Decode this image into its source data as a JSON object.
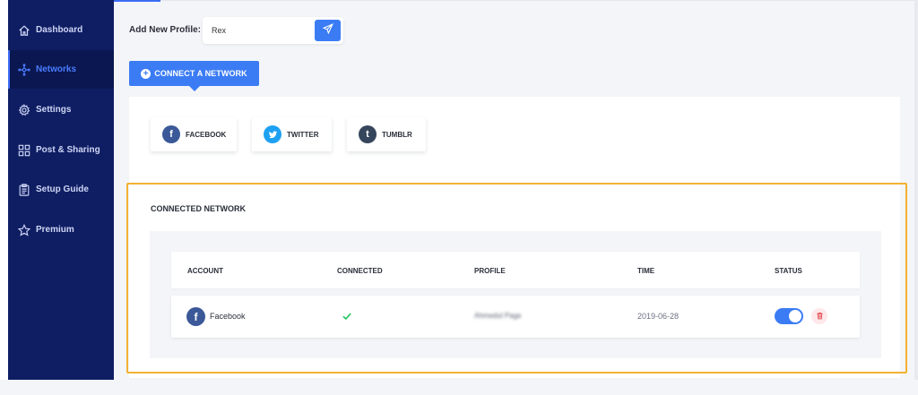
{
  "sidebar": {
    "items": [
      {
        "label": "Dashboard",
        "icon": "home-icon"
      },
      {
        "label": "Networks",
        "icon": "network-icon",
        "active": true
      },
      {
        "label": "Settings",
        "icon": "gear-icon"
      },
      {
        "label": "Post & Sharing",
        "icon": "layout-icon"
      },
      {
        "label": "Setup Guide",
        "icon": "clipboard-icon"
      },
      {
        "label": "Premium",
        "icon": "star-icon"
      }
    ]
  },
  "profile": {
    "label": "Add New Profile:",
    "value": "Rex",
    "send_icon": "paper-plane-icon"
  },
  "connect_button": {
    "label": "CONNECT A NETWORK",
    "icon": "plus-circle-icon"
  },
  "networks": [
    {
      "label": "FACEBOOK",
      "icon": "facebook-icon",
      "color": "#3b5998"
    },
    {
      "label": "TWITTER",
      "icon": "twitter-icon",
      "color": "#1da1f2"
    },
    {
      "label": "TUMBLR",
      "icon": "tumblr-icon",
      "color": "#35465c"
    }
  ],
  "connected": {
    "title": "CONNECTED NETWORK",
    "columns": [
      "ACCOUNT",
      "CONNECTED",
      "PROFILE",
      "TIME",
      "STATUS"
    ],
    "rows": [
      {
        "account": "Facebook",
        "account_icon": "facebook-icon",
        "connected_icon": "checkmark-icon",
        "profile": "Ahmedul Page",
        "time": "2019-06-28",
        "status_on": true,
        "delete_icon": "trash-icon"
      }
    ]
  },
  "colors": {
    "sidebar_bg": "#0f1e63",
    "accent": "#3b7cf5",
    "highlight_border": "#f2b233",
    "check": "#22c55e",
    "delete": "#e5484d"
  }
}
